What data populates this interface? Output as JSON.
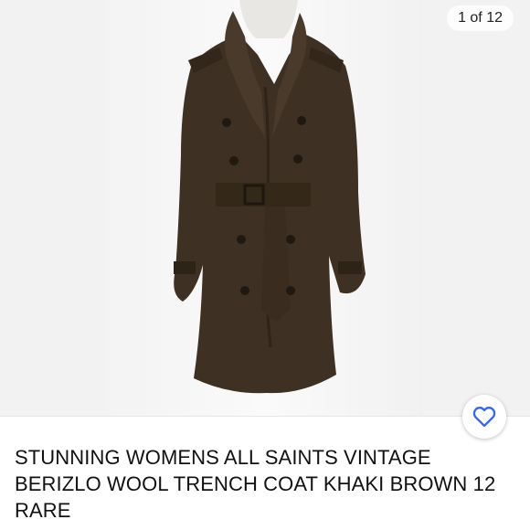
{
  "gallery": {
    "counter": "1 of 12",
    "image_alt": "Brown wool trench coat on mannequin"
  },
  "favorite": {
    "icon": "heart-outline-icon",
    "color": "#3665f3"
  },
  "listing": {
    "title": "STUNNING WOMENS ALL SAINTS VINTAGE BERIZLO WOOL TRENCH COAT KHAKI BROWN 12 RARE"
  }
}
